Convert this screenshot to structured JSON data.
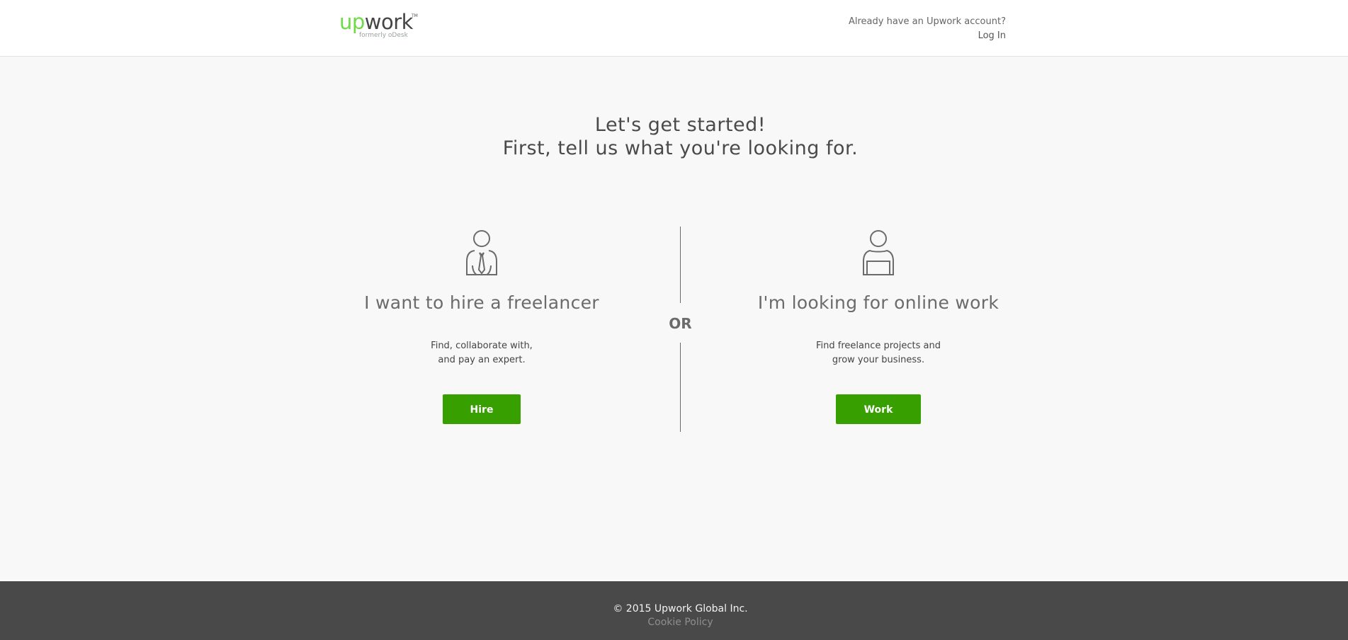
{
  "header": {
    "logo_up": "up",
    "logo_work": "work",
    "logo_tm": "TM",
    "logo_formerly": "formerly oDesk",
    "account_text": "Already have an Upwork account?",
    "login_label": "Log In"
  },
  "title": {
    "line1": "Let's get started!",
    "line2": "First, tell us what you're looking for."
  },
  "hire": {
    "icon": "client-person-tie-icon",
    "heading": "I want to hire a freelancer",
    "desc_line1": "Find, collaborate with,",
    "desc_line2": "and pay an expert.",
    "button_label": "Hire"
  },
  "divider": {
    "label": "OR"
  },
  "work": {
    "icon": "freelancer-person-laptop-icon",
    "heading": "I'm looking for online work",
    "desc_line1": "Find freelance projects and",
    "desc_line2": "grow your business.",
    "button_label": "Work"
  },
  "footer": {
    "copyright": "© 2015 Upwork Global Inc.",
    "cookie_policy": "Cookie Policy"
  },
  "colors": {
    "brand_green": "#6fda44",
    "button_green": "#37a000",
    "footer_bg": "#494949",
    "page_bg": "#f8f8f8"
  }
}
